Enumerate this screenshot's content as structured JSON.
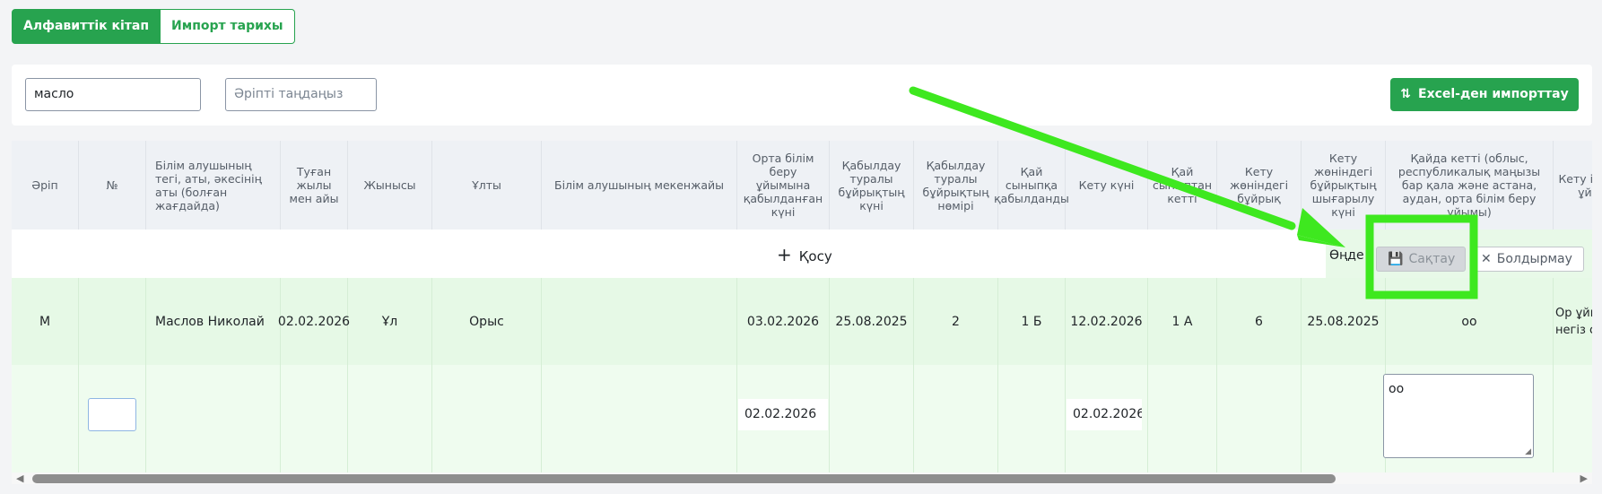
{
  "tabs": [
    {
      "label": "Алфавиттік кітап",
      "active": true
    },
    {
      "label": "Импорт тарихы",
      "active": false
    }
  ],
  "filters": {
    "search_value": "масло",
    "letter_placeholder": "Әріпті таңдаңыз",
    "import_button": "Excel-ден импорттау",
    "import_icon": "sort-arrows-icon"
  },
  "table": {
    "headers": [
      "Әріп",
      "№",
      "Білім алушының тегі, аты, әкесінің аты (болған жағдайда)",
      "Туған жылы мен айы",
      "Жынысы",
      "Ұлты",
      "Білім алушының мекенжайы",
      "Орта білім беру ұйымына қабылданған күні",
      "Қабылдау туралы бұйрықтың күні",
      "Қабылдау туралы бұйрықтың нөмірі",
      "Қай сыныпқа қабылданды",
      "Кету күні",
      "Қай сыныптан кетті",
      "Кету жөніндегі бұйрық",
      "Кету жөніндегі бұйрықтың шығарылу күні",
      "Қайда кетті (облыс, республикалық маңызы бар қала және астана, аудан, орта білім беру ұйымы)",
      "Кету ішінде ұйым"
    ],
    "add_label": "Қосу",
    "edit_label": "Өңде",
    "save_label": "Сақтау",
    "cancel_label": "Болдырмау",
    "row": {
      "letter": "М",
      "number": "",
      "name": "Маслов Николай",
      "birth": "02.02.2026",
      "gender": "Ұл",
      "nationality": "Орыс",
      "address": "",
      "admission_date": "03.02.2026",
      "order_date": "25.08.2025",
      "order_number": "2",
      "admitted_class": "1 Б",
      "leave_date": "12.02.2026",
      "left_class": "1 А",
      "leave_order": "6",
      "leave_order_date": "25.08.2025",
      "destination": "оо",
      "extra": "Ор ұйым негіз с"
    },
    "edit_row": {
      "admission_date": "02.02.2026",
      "leave_date": "02.02.2026",
      "destination": "оо"
    }
  },
  "colors": {
    "primary": "#27a34f",
    "annotation": "#3ee81f",
    "row_highlight": "#e6f9e6"
  }
}
